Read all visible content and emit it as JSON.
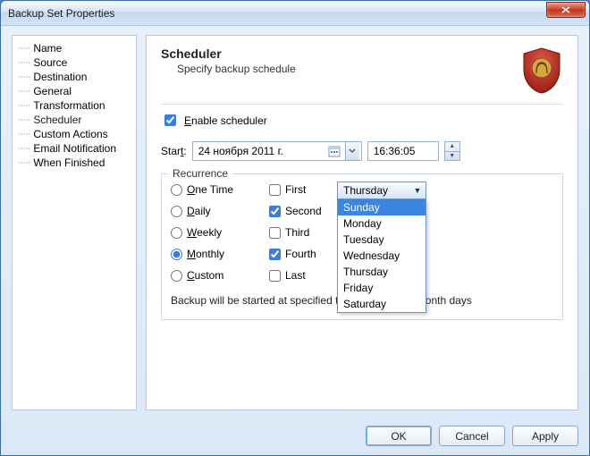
{
  "window": {
    "title": "Backup Set Properties"
  },
  "nav": {
    "items": [
      {
        "label": "Name"
      },
      {
        "label": "Source"
      },
      {
        "label": "Destination"
      },
      {
        "label": "General"
      },
      {
        "label": "Transformation"
      },
      {
        "label": "Scheduler"
      },
      {
        "label": "Custom Actions"
      },
      {
        "label": "Email Notification"
      },
      {
        "label": "When Finished"
      }
    ],
    "selected_index": 5
  },
  "header": {
    "title": "Scheduler",
    "subtitle": "Specify backup schedule"
  },
  "enable": {
    "label": "Enable scheduler",
    "checked": true
  },
  "start": {
    "label": "Start:",
    "date": "24  ноября  2011 г.",
    "time": "16:36:05"
  },
  "recurrence": {
    "legend": "Recurrence",
    "radios": [
      {
        "label": "One Time",
        "checked": false
      },
      {
        "label": "Daily",
        "checked": false
      },
      {
        "label": "Weekly",
        "checked": false
      },
      {
        "label": "Monthly",
        "checked": true
      },
      {
        "label": "Custom",
        "checked": false
      }
    ],
    "ordinals": [
      {
        "label": "First",
        "checked": false
      },
      {
        "label": "Second",
        "checked": true
      },
      {
        "label": "Third",
        "checked": false
      },
      {
        "label": "Fourth",
        "checked": true
      },
      {
        "label": "Last",
        "checked": false
      }
    ],
    "day_selected": "Thursday",
    "day_highlight": "Sunday",
    "days": [
      "Sunday",
      "Monday",
      "Tuesday",
      "Wednesday",
      "Thursday",
      "Friday",
      "Saturday"
    ],
    "note": "Backup will be started at specified time on selected month days"
  },
  "buttons": {
    "ok": "OK",
    "cancel": "Cancel",
    "apply": "Apply"
  }
}
